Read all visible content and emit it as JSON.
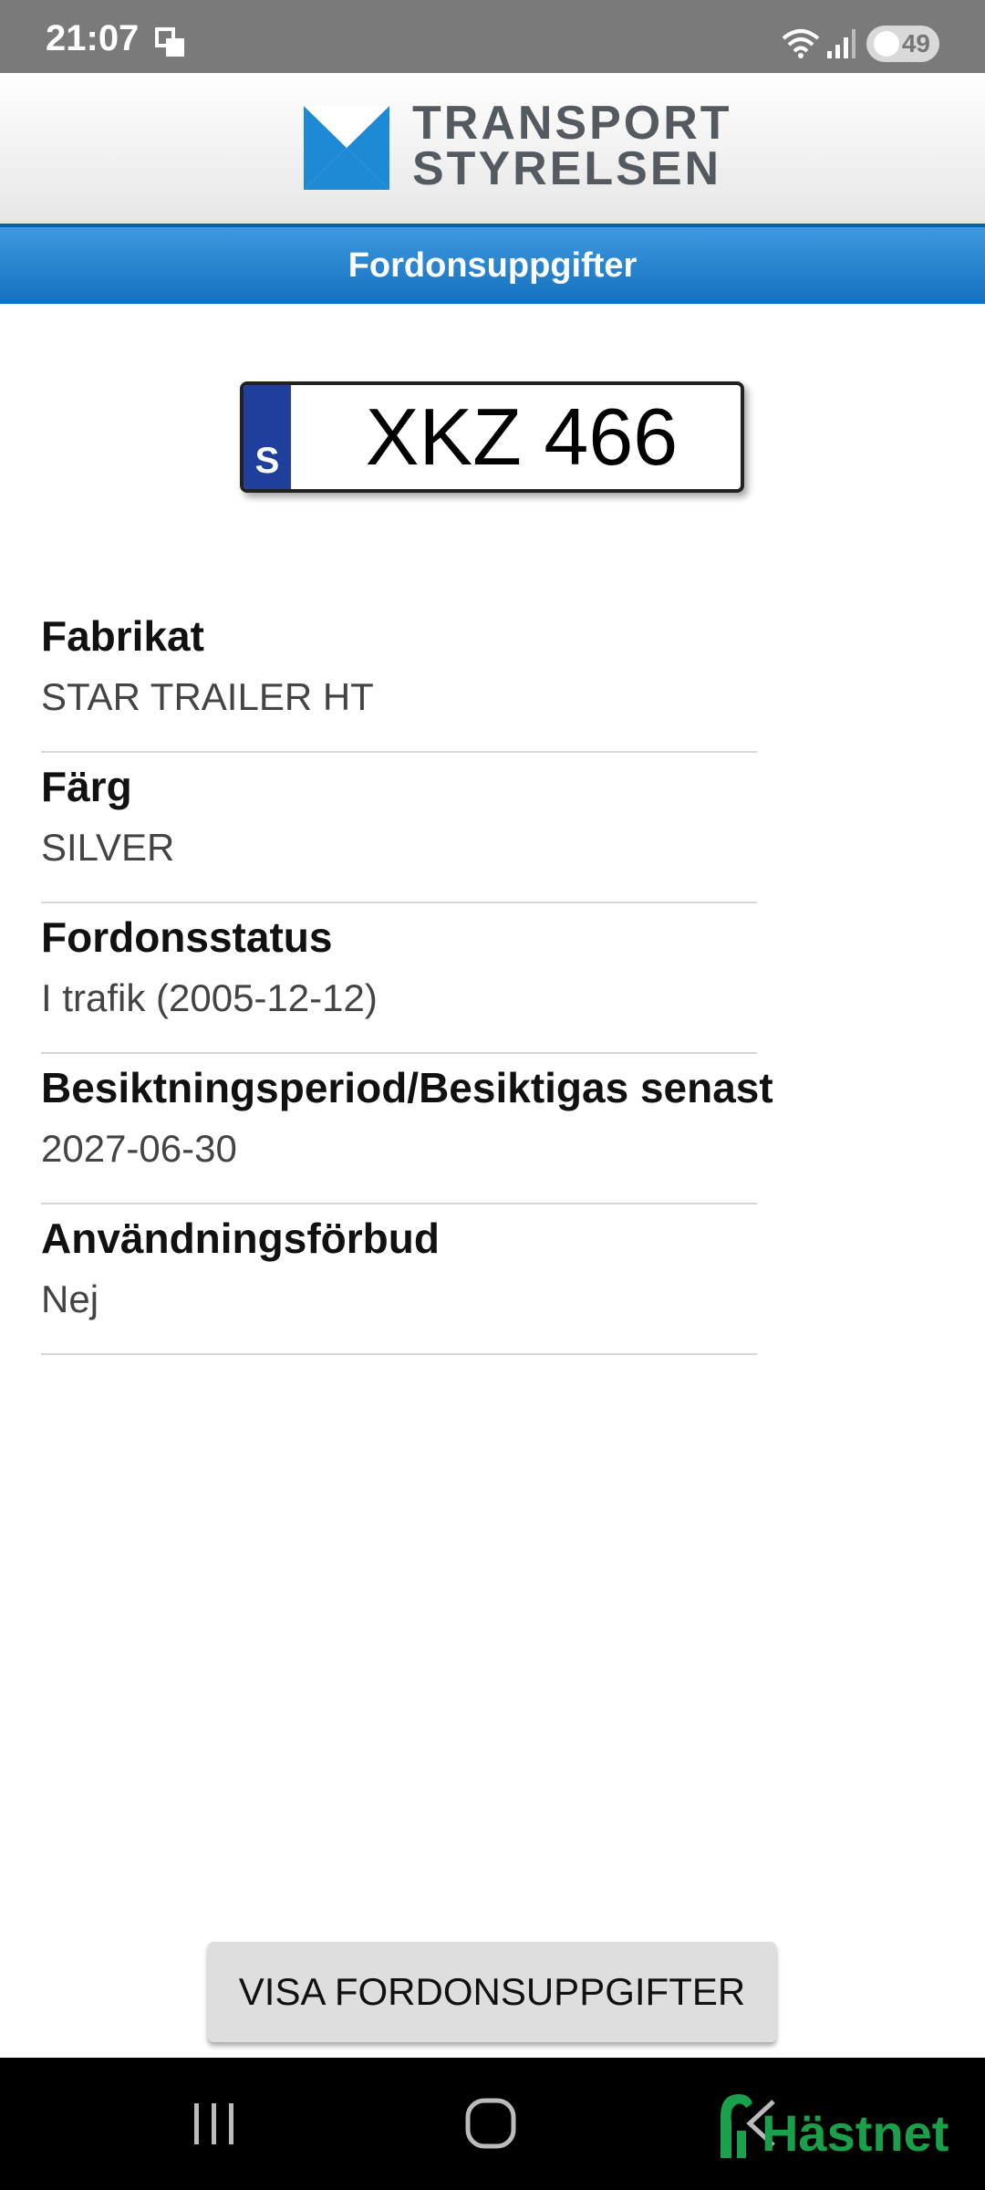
{
  "status_bar": {
    "time": "21:07",
    "battery": "49"
  },
  "header": {
    "logo_line1": "TRANSPORT",
    "logo_line2": "STYRELSEN",
    "title": "Fordonsuppgifter"
  },
  "plate": {
    "country": "S",
    "number": "XKZ 466"
  },
  "details": [
    {
      "label": "Fabrikat",
      "value": "STAR TRAILER HT"
    },
    {
      "label": "Färg",
      "value": "SILVER"
    },
    {
      "label": "Fordonsstatus",
      "value": "I trafik (2005-12-12)"
    },
    {
      "label": "Besiktningsperiod/Besiktigas senast",
      "value": "2027-06-30"
    },
    {
      "label": "Användningsförbud",
      "value": "Nej"
    }
  ],
  "button": {
    "label": "VISA FORDONSUPPGIFTER"
  },
  "watermark": {
    "text": "Hästnet"
  },
  "colors": {
    "brand_blue": "#146fbf",
    "logo_blue": "#1e8ad6",
    "logo_grey": "#555a60",
    "watermark_green": "#1aa04b"
  }
}
